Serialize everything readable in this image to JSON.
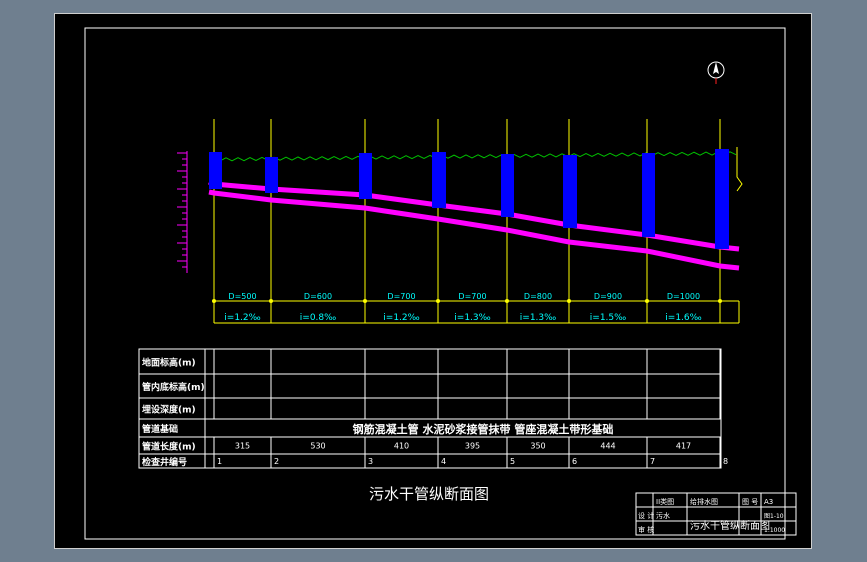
{
  "drawing_title": "污水干管纵断面图",
  "colors": {
    "background": "#000000",
    "viewport": "#6f7f8f",
    "frame": "#ffffff",
    "station_line": "#ffff00",
    "pipe": "#ff00ff",
    "manhole": "#0000ff",
    "ground": "#00c000",
    "labels": "#00ffff",
    "table_text": "#ffffff"
  },
  "north_icon": "north-arrow-icon",
  "profile": {
    "segments": [
      {
        "diameter": "D=500",
        "slope": "i=1.2‰"
      },
      {
        "diameter": "D=600",
        "slope": "i=0.8‰"
      },
      {
        "diameter": "D=700",
        "slope": "i=1.2‰"
      },
      {
        "diameter": "D=700",
        "slope": "i=1.3‰"
      },
      {
        "diameter": "D=800",
        "slope": "i=1.3‰"
      },
      {
        "diameter": "D=900",
        "slope": "i=1.5‰"
      },
      {
        "diameter": "D=1000",
        "slope": "i=1.6‰"
      }
    ]
  },
  "table": {
    "row_labels": [
      "地面标高(m)",
      "管内底标高(m)",
      "埋设深度(m)",
      "管道基础",
      "管道长度(m)",
      "检查井编号"
    ],
    "foundation_text": "钢筋混凝土管 水泥砂浆接管抹带    管座混凝土带形基础",
    "lengths": [
      "315",
      "530",
      "410",
      "395",
      "350",
      "444",
      "417"
    ],
    "manhole_numbers": [
      "1",
      "2",
      "3",
      "4",
      "5",
      "6",
      "7",
      "8"
    ]
  },
  "title_block": {
    "cells": [
      "II类图",
      "给排水图",
      "图 号",
      "A3",
      "设 计",
      "污水",
      "污水干管纵断面图",
      "图1-10",
      "审 核",
      "1:1000"
    ]
  }
}
